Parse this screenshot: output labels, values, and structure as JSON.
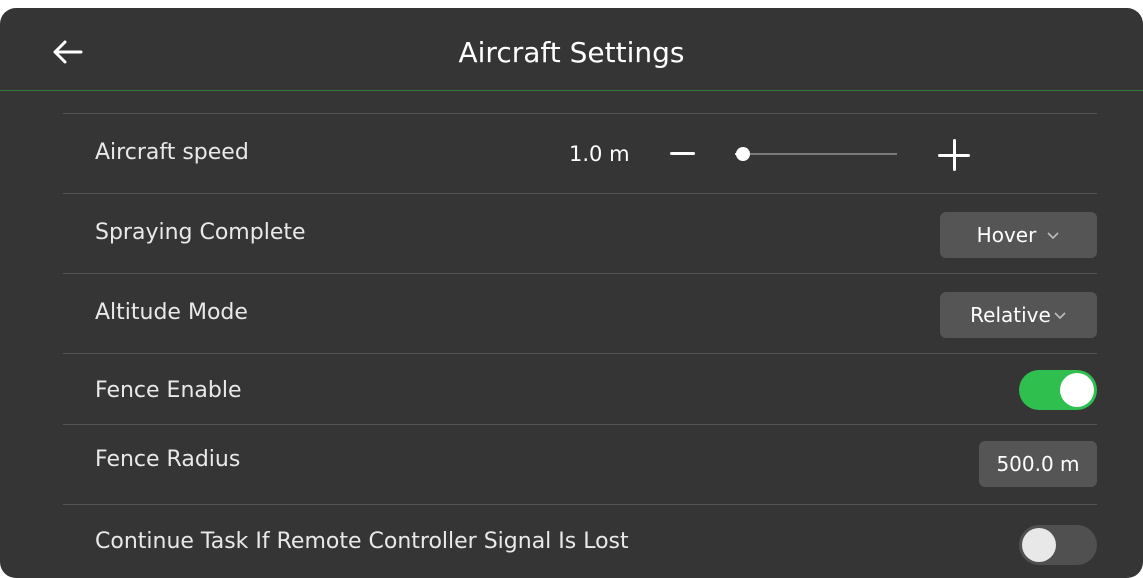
{
  "header": {
    "title": "Aircraft Settings",
    "back_icon": "arrow-left-icon"
  },
  "rows": {
    "speed": {
      "label": "Aircraft speed",
      "value": "1.0 m",
      "slider_fraction": 0.05
    },
    "spraying": {
      "label": "Spraying Complete",
      "selected": "Hover"
    },
    "altitude": {
      "label": "Altitude Mode",
      "selected": "Relative"
    },
    "fence_enable": {
      "label": "Fence Enable",
      "on": true
    },
    "fence_radius": {
      "label": "Fence Radius",
      "value": "500.0 m"
    },
    "continue_task": {
      "label": "Continue Task If Remote Controller Signal Is Lost",
      "on": false
    }
  },
  "colors": {
    "panel_bg": "#353535",
    "accent_green": "#2fbf4f",
    "control_bg": "#555555"
  }
}
